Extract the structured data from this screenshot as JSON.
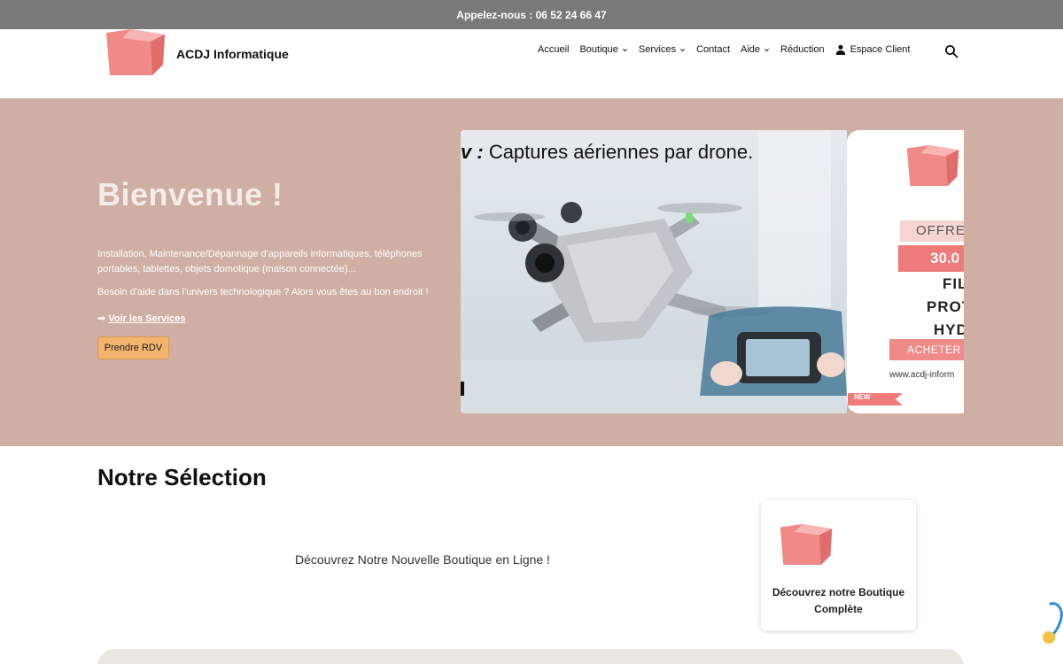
{
  "topbar": {
    "text": "Appelez-nous : 06 52 24 66 47"
  },
  "header": {
    "brand": "ACDJ Informatique",
    "nav": [
      {
        "label": "Accueil",
        "dropdown": false
      },
      {
        "label": "Boutique",
        "dropdown": true
      },
      {
        "label": "Services",
        "dropdown": true
      },
      {
        "label": "Contact",
        "dropdown": false
      },
      {
        "label": "Aide",
        "dropdown": true
      },
      {
        "label": "Réduction",
        "dropdown": false
      },
      {
        "label": "Espace Client",
        "dropdown": false,
        "icon": "user-icon"
      }
    ],
    "search_icon": "search-icon"
  },
  "hero": {
    "title": "Bienvenue !",
    "paragraph1": "Installation, Maintenance/Dépannage d'appareils informatiques, téléphones portables, tablettes, objets domotique (maison connectée)...",
    "paragraph2": "Besoin d'aide dans l'univers technologique ? Alors vous êtes au bon endroit !",
    "link_prefix": "➡",
    "link_label": "Voir les Services",
    "cta_label": "Prendre RDV",
    "slide_caption_cut": "v :",
    "slide_caption": "Captures aériennes par drone.",
    "slide_side": {
      "bar1": "OFFRE",
      "bar2": "30.0",
      "line1": "FIL",
      "line2": "PROT",
      "line3": "HYD",
      "buy": "ACHETER",
      "url": "www.acdj-inform",
      "badge": "NEW"
    }
  },
  "selection": {
    "title": "Notre Sélection",
    "promo": "Découvrez Notre Nouvelle Boutique en Ligne !",
    "card_label": "Découvrez notre Boutique Complète"
  },
  "colors": {
    "topbar": "#7a7a7a",
    "hero_bg": "#cfaea3",
    "accent_button": "#f2b36d",
    "logo_pink": "#ef8a88"
  }
}
